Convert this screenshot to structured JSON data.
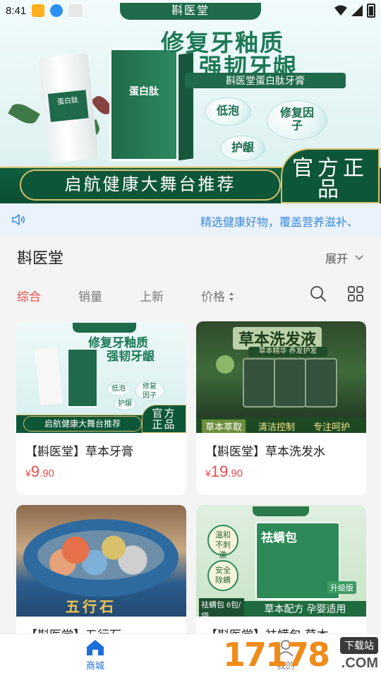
{
  "status_bar": {
    "time": "8:41"
  },
  "banner": {
    "brand": "斟医堂",
    "headline_line1": "修复牙釉质",
    "headline_line2": "强韧牙龈",
    "product_name": "斟医堂蛋白肽牙膏",
    "tube_label": "蛋白肽",
    "box_label": "蛋白肽",
    "bubble_1": "低泡",
    "bubble_2": "修复因子",
    "bubble_3": "护龈",
    "footer_text": "启航健康大舞台推荐",
    "seal_text": "官方正品"
  },
  "notice": {
    "icon": "speaker-icon",
    "text": "精选健康好物，覆盖营养滋补、"
  },
  "shop": {
    "title": "斟医堂",
    "expand_label": "展开"
  },
  "sort_tabs": [
    {
      "label": "综合",
      "active": true
    },
    {
      "label": "销量",
      "active": false
    },
    {
      "label": "上新",
      "active": false
    },
    {
      "label": "价格",
      "active": false
    }
  ],
  "products": [
    {
      "name": "【斟医堂】草本牙膏",
      "price_currency": "¥",
      "price_int": "9",
      "price_dec": ".90",
      "image": {
        "line1": "修复牙釉质",
        "line2": "强韧牙龈",
        "footer": "启航健康大舞台推荐",
        "seal": "官方正品",
        "b1": "低泡",
        "b2": "修复因子",
        "b3": "护龈"
      }
    },
    {
      "name": "【斟医堂】草本洗发水",
      "price_currency": "¥",
      "price_int": "19",
      "price_dec": ".90",
      "image": {
        "title": "草本洗发液",
        "subtitle": "草本精华 养发护发",
        "tag1": "草本萃取",
        "tag2": "清洁控制",
        "tag3": "专注呵护"
      }
    },
    {
      "name": "【斟医堂】五行石",
      "price_currency": "¥",
      "price_int": "",
      "price_dec": "",
      "image": {
        "title": "五行石"
      }
    },
    {
      "name": "【斟医堂】祛螨包 草本…",
      "price_currency": "¥",
      "price_int": "",
      "price_dec": "",
      "image": {
        "title": "祛螨包",
        "tag1": "温和不刺激",
        "tag2": "安全除螨",
        "badge": "升级版",
        "strip": "草本配方 孕婴适用",
        "count": "祛螨包 6包/袋"
      }
    }
  ],
  "tabbar": [
    {
      "label": "商城",
      "active": true
    },
    {
      "label": "我的",
      "active": false
    }
  ],
  "watermark": {
    "number": "17178",
    "tag": "下载站",
    "domain": ".COM"
  },
  "colors": {
    "accent_red": "#ec4b4b",
    "accent_blue": "#1e6fd9",
    "brand_green": "#1f6a4a"
  }
}
